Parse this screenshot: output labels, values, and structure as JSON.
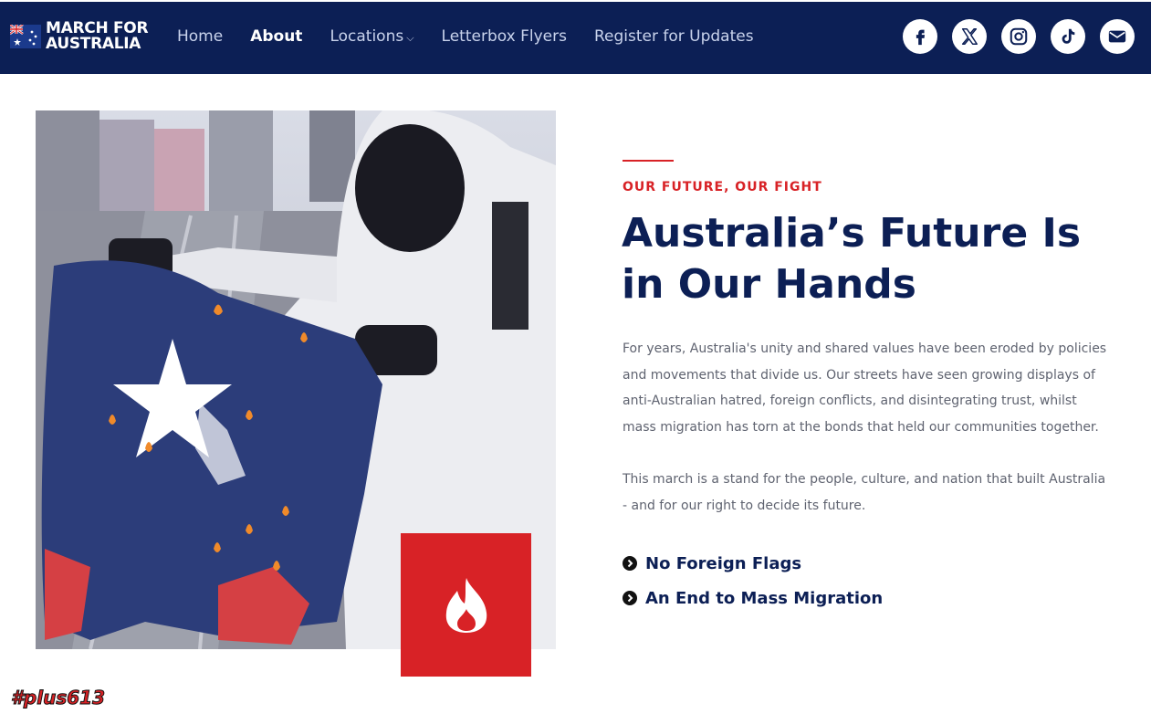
{
  "brand": {
    "line1": "MARCH FOR",
    "line2": "AUSTRALIA"
  },
  "nav": {
    "links": [
      {
        "label": "Home"
      },
      {
        "label": "About"
      },
      {
        "label": "Locations"
      },
      {
        "label": "Letterbox Flyers"
      },
      {
        "label": "Register for Updates"
      }
    ],
    "active": "About",
    "socials": [
      "facebook-icon",
      "x-icon",
      "instagram-icon",
      "tiktok-icon",
      "email-icon"
    ]
  },
  "colors": {
    "navy": "#0c1f55",
    "red": "#d82226",
    "text": "#5f6370"
  },
  "section": {
    "eyebrow": "OUR FUTURE, OUR FIGHT",
    "heading": "Australia’s Future Is in Our Hands",
    "paragraph1": "For years, Australia's unity and shared values have been eroded by policies and movements that divide us. Our streets have seen growing displays of anti-Australian hatred, foreign conflicts, and disintegrating trust, whilst mass migration has torn at the bonds that held our communities together.",
    "paragraph2": "This march is a stand for the people, culture, and nation that built Australia - and for our right to decide its future.",
    "points": [
      "No Foreign Flags",
      "An End to Mass Migration"
    ],
    "badge_icon": "flame-icon"
  },
  "watermark": "#plus613"
}
